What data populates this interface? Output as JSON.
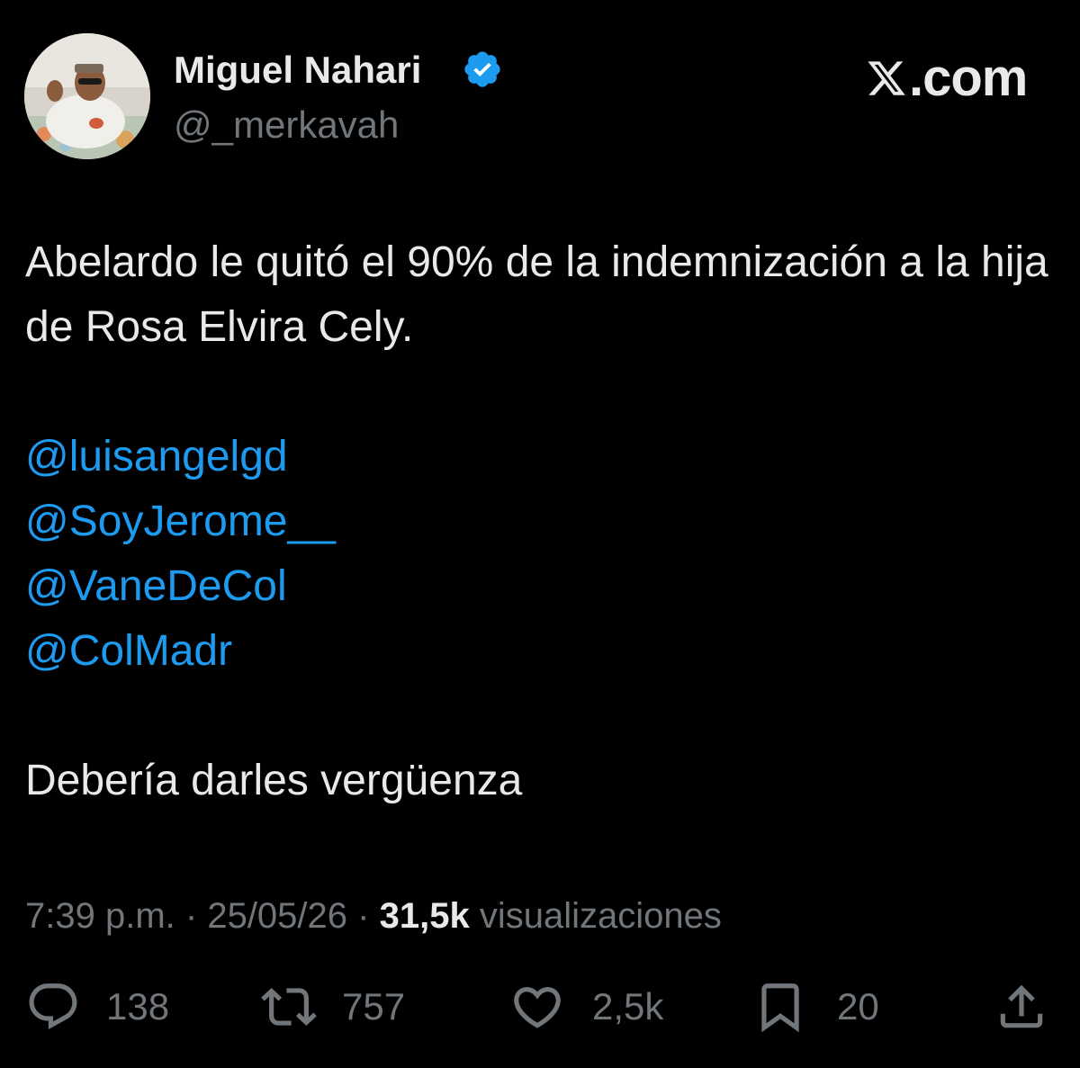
{
  "author": {
    "display_name": "Miguel Nahari",
    "handle": "@_merkavah",
    "verified": true
  },
  "watermark": {
    "text": ".com",
    "logo_icon": "x-logo-icon"
  },
  "tweet": {
    "text_line1": "Abelardo le quitó el 90% de la indemnización a la hija de Rosa Elvira Cely.",
    "mentions": [
      "@luisangelgd",
      "@SoyJerome__",
      "@VaneDeCol",
      "@ColMadr"
    ],
    "closing_text": "Debería darles vergüenza"
  },
  "meta": {
    "time": "7:39 p.m.",
    "date": "25/05/26",
    "views_count": "31,5k",
    "views_label": "visualizaciones"
  },
  "actions": {
    "replies": "138",
    "retweets": "757",
    "likes": "2,5k",
    "bookmarks": "20"
  },
  "colors": {
    "background": "#000000",
    "text": "#e7e9ea",
    "muted": "#71767b",
    "accent": "#1d9bf0"
  }
}
